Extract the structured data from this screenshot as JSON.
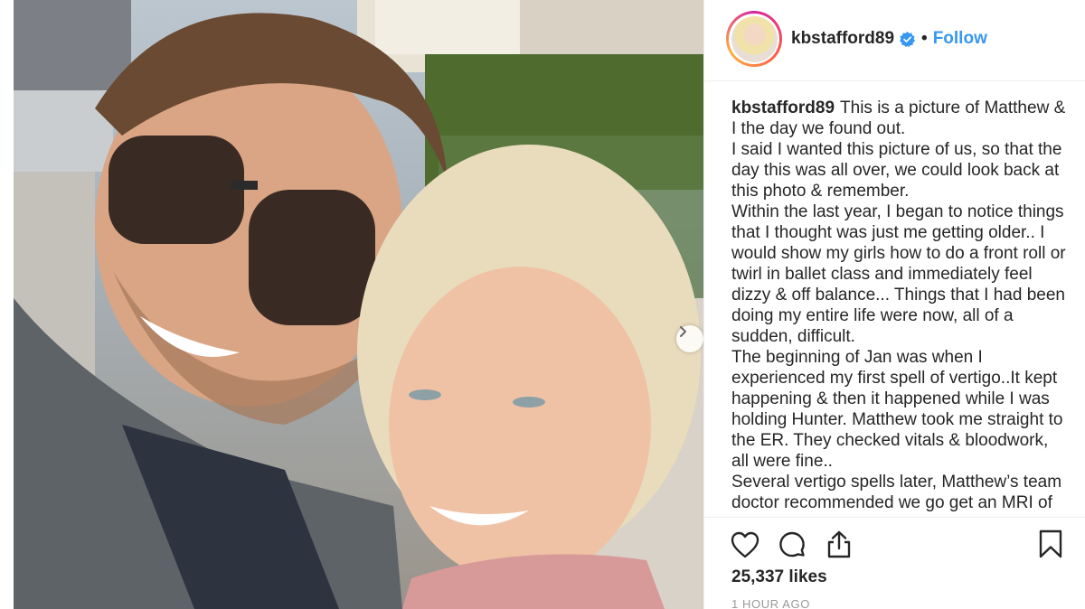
{
  "post": {
    "username": "kbstafford89",
    "separator": "•",
    "follow_label": "Follow",
    "verified_icon": "verified-badge-icon",
    "caption_user": "kbstafford89",
    "caption_paragraphs": [
      "This is a picture of Matthew & I the day we found out.",
      "I said I wanted this picture of us, so that the day this was all over, we could look back at this photo & remember.",
      "Within the last year, I began to notice things that I thought was just me getting older.. I would show my girls how to do a front roll or twirl in ballet class and immediately feel dizzy & off balance... Things that I had been doing my entire life were now, all of a sudden, difficult.",
      "The beginning of Jan was when I experienced my first spell of vertigo..It kept happening & then it happened while I was holding Hunter. Matthew took me straight to the ER. They checked vitals & bloodwork, all were fine..",
      "Several vertigo spells later, Matthew’s team doctor recommended we go get an MRI of"
    ],
    "likes": "25,337 likes",
    "timestamp": "1 HOUR AGO"
  },
  "icons": {
    "like": "heart-icon",
    "comment": "comment-bubble-icon",
    "share": "share-icon",
    "save": "bookmark-icon",
    "next": "chevron-right-icon"
  },
  "colors": {
    "accent": "#3897f0",
    "text": "#262626",
    "muted": "#999999",
    "border": "#efefef"
  }
}
